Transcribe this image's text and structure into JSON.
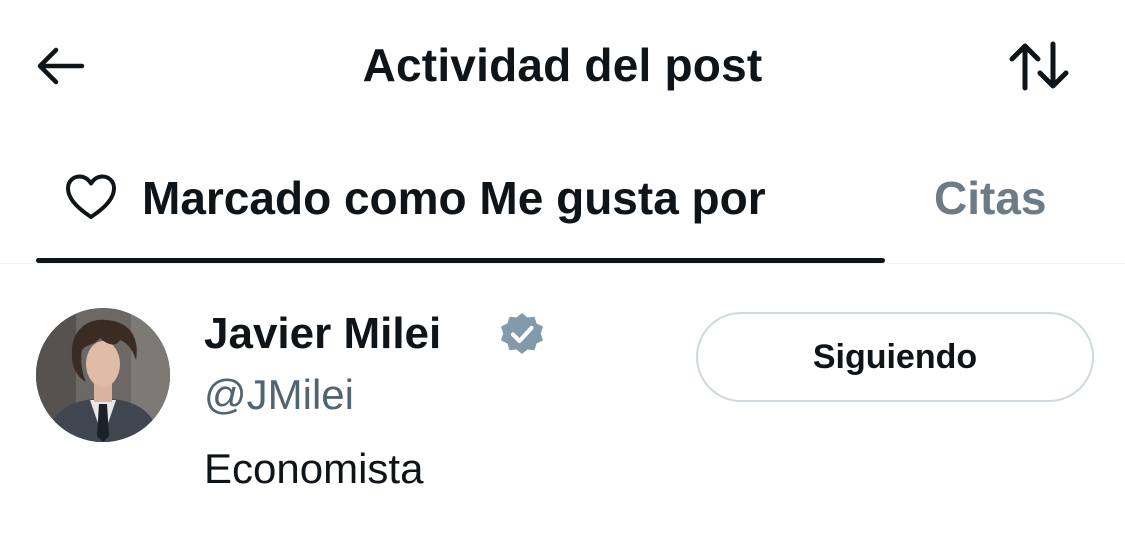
{
  "header": {
    "back_icon": "arrow-left-icon",
    "title": "Actividad del post",
    "sort_icon": "sort-up-down-icon"
  },
  "tabs": [
    {
      "label": "Marcado como Me gusta por",
      "icon": "heart-outline-icon",
      "active": true
    },
    {
      "label": "Citas",
      "active": false
    }
  ],
  "users": [
    {
      "display_name": "Javier Milei",
      "verified": true,
      "verified_badge_color": "#829aab",
      "handle": "@JMilei",
      "bio": "Economista",
      "follow_button_label": "Siguiendo"
    }
  ],
  "colors": {
    "text_primary": "#0f1419",
    "text_secondary": "#536471",
    "tab_indicator": "#0f1419",
    "button_border": "#cfd9de"
  }
}
